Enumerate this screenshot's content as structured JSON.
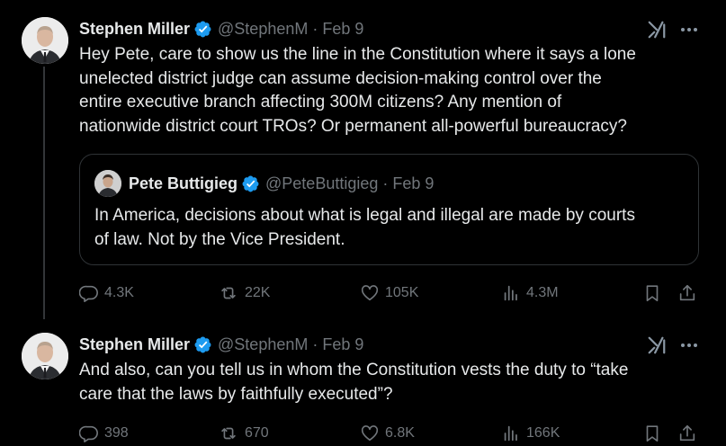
{
  "tweets": [
    {
      "author": "Stephen Miller",
      "handle": "@StephenM",
      "separator": "·",
      "date": "Feb 9",
      "text": "Hey Pete, care to show us the line in the Constitution where it says a lone\nunelected district judge can assume decision-making control over the\nentire executive branch affecting 300M citizens? Any mention of\nnationwide district court TROs? Or permanent all-powerful bureaucracy?",
      "quote": {
        "author": "Pete Buttigieg",
        "handle": "@PeteButtigieg",
        "separator": "·",
        "date": "Feb 9",
        "text": "In America, decisions about what is legal and illegal are made by courts\nof law. Not by the Vice President."
      },
      "stats": {
        "replies": "4.3K",
        "reposts": "22K",
        "likes": "105K",
        "views": "4.3M"
      }
    },
    {
      "author": "Stephen Miller",
      "handle": "@StephenM",
      "separator": "·",
      "date": "Feb 9",
      "text": "And also, can you tell us in whom the Constitution vests the duty to “take\ncare that the laws by faithfully executed”?",
      "stats": {
        "replies": "398",
        "reposts": "670",
        "likes": "6.8K",
        "views": "166K"
      }
    }
  ],
  "colors": {
    "background": "#000000",
    "text": "#e7e9ea",
    "muted": "#71767b",
    "verified": "#1d9bf0",
    "border": "#2f3336"
  },
  "icons": [
    "verified-badge-icon",
    "grok-icon",
    "more-icon",
    "reply-icon",
    "repost-icon",
    "like-icon",
    "views-icon",
    "bookmark-icon",
    "share-icon"
  ]
}
